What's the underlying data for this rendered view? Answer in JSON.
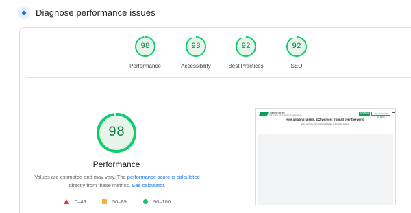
{
  "header": {
    "title": "Diagnose performance issues",
    "icon": "lighthouse-icon"
  },
  "scores": [
    {
      "label": "Performance",
      "value": "98",
      "score": 98
    },
    {
      "label": "Accessibility",
      "value": "93",
      "score": 93
    },
    {
      "label": "Best Practices",
      "value": "92",
      "score": 92
    },
    {
      "label": "SEO",
      "value": "92",
      "score": 92
    }
  ],
  "main_score": {
    "value": "98",
    "score": 98,
    "title": "Performance"
  },
  "note": {
    "part1": "Values are estimated and may vary. The ",
    "link1": "performance score is calculated",
    "part2": " directly from these metrics. ",
    "link2": "See calculator",
    "part3": "."
  },
  "legend": [
    {
      "range": "0–49",
      "shape": "triangle",
      "color": "#e53935"
    },
    {
      "range": "50–89",
      "shape": "square",
      "color": "#fbaf33"
    },
    {
      "range": "90–100",
      "shape": "circle",
      "color": "#17c26f"
    }
  ],
  "screenshot": {
    "brand": "TalentsForHire",
    "tagline": "The biggest hiring network of global talents",
    "button_primary": "JOIN FREE",
    "button_secondary": "HIRE FROM 80K TALENTS",
    "headline": "Hire amazing talents, 422 workers from all over the world",
    "subline": "Hire and if you enjoy the current details of any of the workers"
  },
  "colors": {
    "pass": "#0cce6b",
    "pass_text": "#0b8043",
    "pass_bg": "#e6f4ea",
    "link": "#1a73e8"
  }
}
